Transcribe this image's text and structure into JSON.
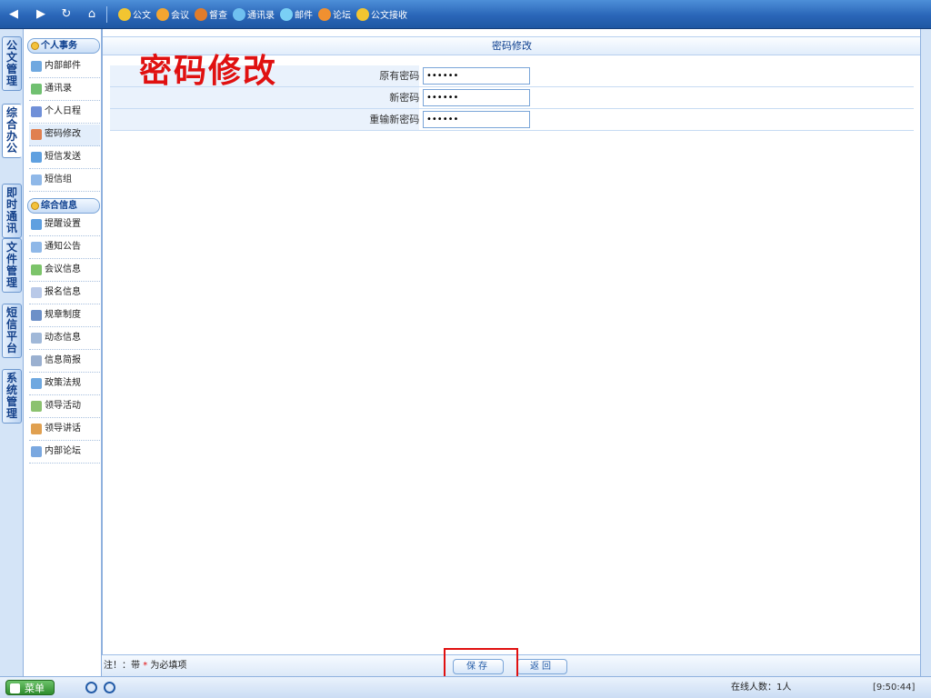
{
  "toolbar": {
    "items": [
      {
        "label": "公文",
        "icon": "document-icon",
        "color": "#f2c531"
      },
      {
        "label": "会议",
        "icon": "meeting-icon",
        "color": "#f2a531"
      },
      {
        "label": "督查",
        "icon": "inspect-icon",
        "color": "#e07c2c"
      },
      {
        "label": "通讯录",
        "icon": "addressbook-icon",
        "color": "#6fc0f0"
      },
      {
        "label": "邮件",
        "icon": "mail-icon",
        "color": "#7ad0f5"
      },
      {
        "label": "论坛",
        "icon": "forum-icon",
        "color": "#f09030"
      },
      {
        "label": "公文接收",
        "icon": "receive-icon",
        "color": "#f2c531"
      }
    ]
  },
  "vtabs": [
    "公文管理",
    "综合办公",
    "即时通讯",
    "文件管理",
    "短信平台",
    "系统管理"
  ],
  "tree": {
    "group1": "个人事务",
    "group1_items": [
      "内部邮件",
      "通讯录",
      "个人日程",
      "密码修改",
      "短信发送",
      "短信组"
    ],
    "group2": "综合信息",
    "group2_items": [
      "提醒设置",
      "通知公告",
      "会议信息",
      "报名信息",
      "规章制度",
      "动态信息",
      "信息简报",
      "政策法规",
      "领导活动",
      "领导讲话",
      "内部论坛"
    ]
  },
  "main": {
    "title": "密码修改",
    "big_title": "密码修改",
    "fields": [
      {
        "label": "原有密码:",
        "value": "111111"
      },
      {
        "label": "新密码:",
        "value": "111111"
      },
      {
        "label": "重输新密码:",
        "value": "111111"
      }
    ]
  },
  "footer": {
    "note_prefix": "注！：带",
    "note_star": "*",
    "note_suffix": "为必填项",
    "save": "保存",
    "back": "返回"
  },
  "status": {
    "menu": "菜单",
    "online": "在线人数：1人",
    "clock": "[9:50:44]"
  }
}
